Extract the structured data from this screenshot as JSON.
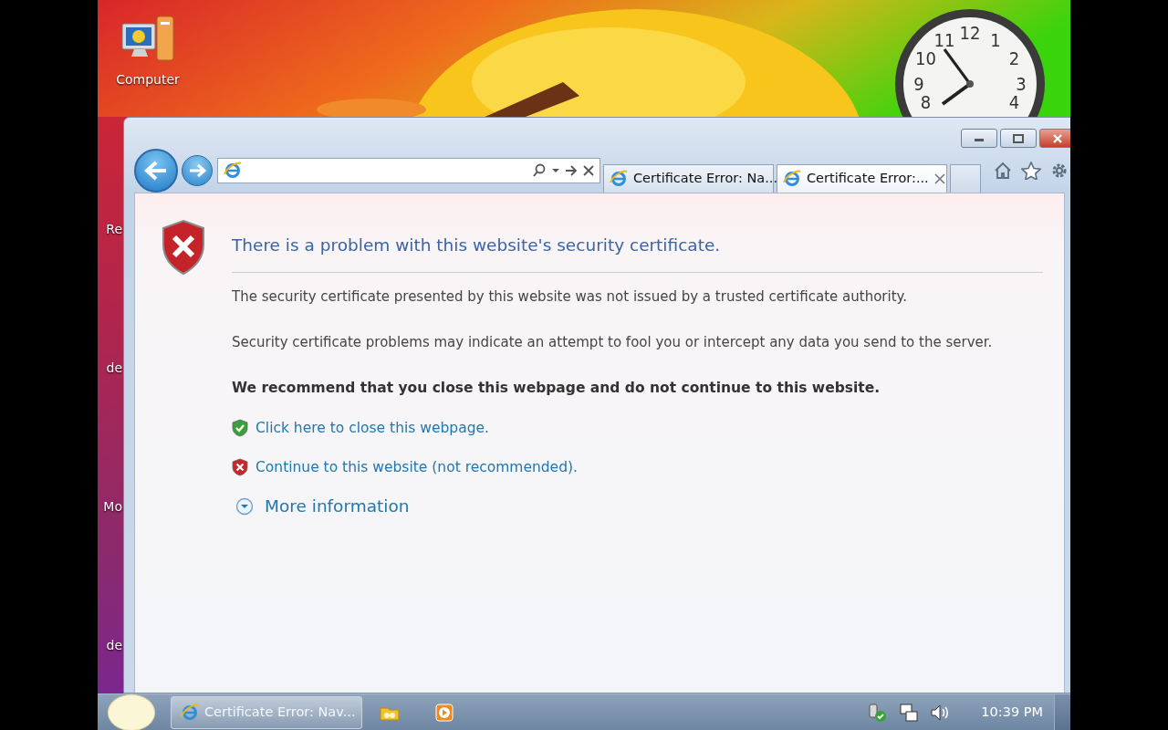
{
  "desktop": {
    "icons": [
      {
        "label": "Computer",
        "clipped": false
      },
      {
        "label": "Re",
        "clipped": true
      },
      {
        "label": "de",
        "clipped": true
      },
      {
        "label": "Mo",
        "clipped": true
      },
      {
        "label": "de",
        "clipped": true
      }
    ],
    "clock_gadget": {
      "numerals": [
        "12",
        "11",
        "1",
        "10",
        "2",
        "9",
        "3",
        "8",
        "4"
      ]
    }
  },
  "browser": {
    "tabs": [
      {
        "title": "Certificate Error: Na...",
        "selected": false
      },
      {
        "title": "Certificate Error:...",
        "selected": true
      }
    ],
    "page": {
      "heading": "There is a problem with this website's security certificate.",
      "paragraphs": [
        "The security certificate presented by this website was not issued by a trusted certificate authority.",
        "Security certificate problems may indicate an attempt to fool you or intercept any data you send to the server."
      ],
      "recommendation": "We recommend that you close this webpage and do not continue to this website.",
      "options": [
        {
          "kind": "safe",
          "text": "Click here to close this webpage."
        },
        {
          "kind": "unsafe",
          "text": "Continue to this website (not recommended)."
        }
      ],
      "more_information": {
        "text": "More information",
        "expanded": false
      }
    }
  },
  "taskbar": {
    "items": [
      {
        "kind": "browser",
        "label": "Certificate Error: Nav..."
      },
      {
        "kind": "folder"
      },
      {
        "kind": "media"
      }
    ],
    "time": "10:39 PM"
  }
}
